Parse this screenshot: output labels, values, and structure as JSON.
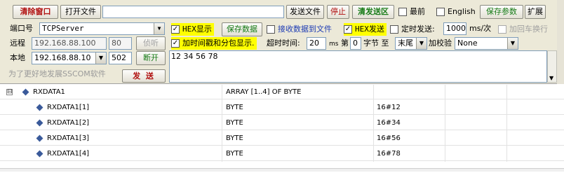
{
  "toolbar": {
    "clear_window": "清除窗口",
    "open_file": "打开文件",
    "send_file": "发送文件",
    "stop": "停止",
    "clear_send_area": "清发送区",
    "topmost": "最前",
    "english": "English",
    "save_params": "保存参数",
    "expand": "扩展"
  },
  "connection": {
    "port_label": "端口号",
    "port_value": "TCPServer",
    "remote_label": "远程",
    "remote_ip": "192.168.88.100",
    "remote_port": "80",
    "listen_button": "侦听",
    "local_label": "本地",
    "local_ip": "192.168.88.10",
    "local_port": "502",
    "disconnect_button": "断开",
    "promo_text": "为了更好地发展SSCOM软件",
    "send_button": "发 送"
  },
  "options": {
    "hex_display": "HEX显示",
    "hex_display_checked": "✓",
    "save_data": "保存数据",
    "recv_to_file": "接收数据到文件",
    "hex_send": "HEX发送",
    "hex_send_checked": "✓",
    "timed_send": "定时发送:",
    "interval_value": "1000",
    "interval_unit": "ms/次",
    "add_crlf": "加回车换行",
    "timestamp": "加时间戳和分包显示.",
    "timestamp_checked": "✓",
    "timeout_label": "超时时间:",
    "timeout_value": "20",
    "timeout_unit": "ms",
    "byte_prefix": "第",
    "byte_index": "0",
    "byte_suffix": "字节 至",
    "byte_end": "末尾",
    "checksum_label": "加校验",
    "checksum_value": "None"
  },
  "send_area": {
    "text": "12 34 56 78"
  },
  "tree": {
    "expander": "⊟",
    "rows": [
      {
        "name": "RXDATA1",
        "type": "ARRAY [1..4] OF BYTE",
        "value": ""
      },
      {
        "name": "RXDATA1[1]",
        "type": "BYTE",
        "value": "16#12"
      },
      {
        "name": "RXDATA1[2]",
        "type": "BYTE",
        "value": "16#34"
      },
      {
        "name": "RXDATA1[3]",
        "type": "BYTE",
        "value": "16#56"
      },
      {
        "name": "RXDATA1[4]",
        "type": "BYTE",
        "value": "16#78"
      }
    ]
  },
  "colors": {
    "panel_bg": "#ece9d8",
    "highlight_yellow": "#ffff00",
    "accent_green": "#157a15",
    "accent_red": "#b01010",
    "tree_icon": "#3a5a9a"
  }
}
